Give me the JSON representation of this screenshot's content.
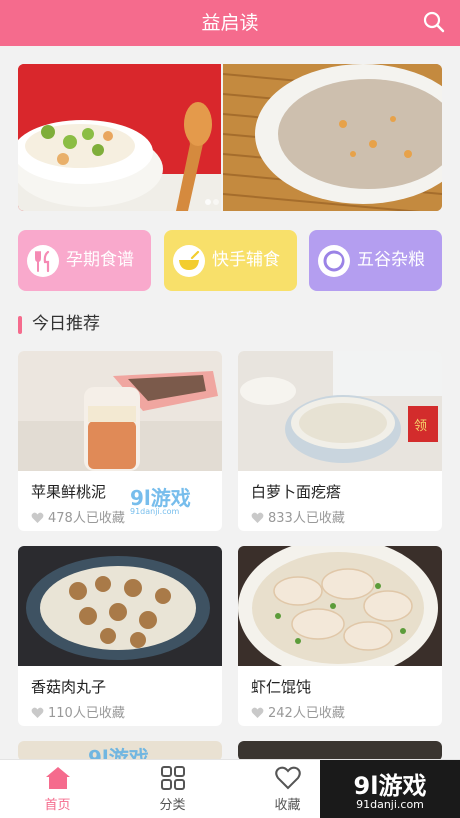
{
  "header": {
    "title": "益启读",
    "search_icon": "search-icon"
  },
  "categories": [
    {
      "label": "孕期食谱",
      "icon": "fork-knife-icon",
      "color": "#f9a9cc"
    },
    {
      "label": "快手辅食",
      "icon": "bowl-icon",
      "color": "#f8e06a"
    },
    {
      "label": "五谷杂粮",
      "icon": "grain-icon",
      "color": "#b49ef0"
    }
  ],
  "section": {
    "title": "今日推荐"
  },
  "recipes": [
    {
      "name": "苹果鲜桃泥",
      "favorites": "478人已收藏"
    },
    {
      "name": "白萝卜面疙瘩",
      "favorites": "833人已收藏"
    },
    {
      "name": "香菇肉丸子",
      "favorites": "110人已收藏"
    },
    {
      "name": "虾仁馄饨",
      "favorites": "242人已收藏"
    }
  ],
  "watermarks": {
    "logo": "9l游戏",
    "url": "91danji.com"
  },
  "tabs": [
    {
      "label": "首页",
      "icon": "home-icon",
      "active": true
    },
    {
      "label": "分类",
      "icon": "grid-icon",
      "active": false
    },
    {
      "label": "收藏",
      "icon": "heart-icon",
      "active": false
    }
  ],
  "colors": {
    "primary": "#f56b8d",
    "text_muted": "#999999"
  }
}
